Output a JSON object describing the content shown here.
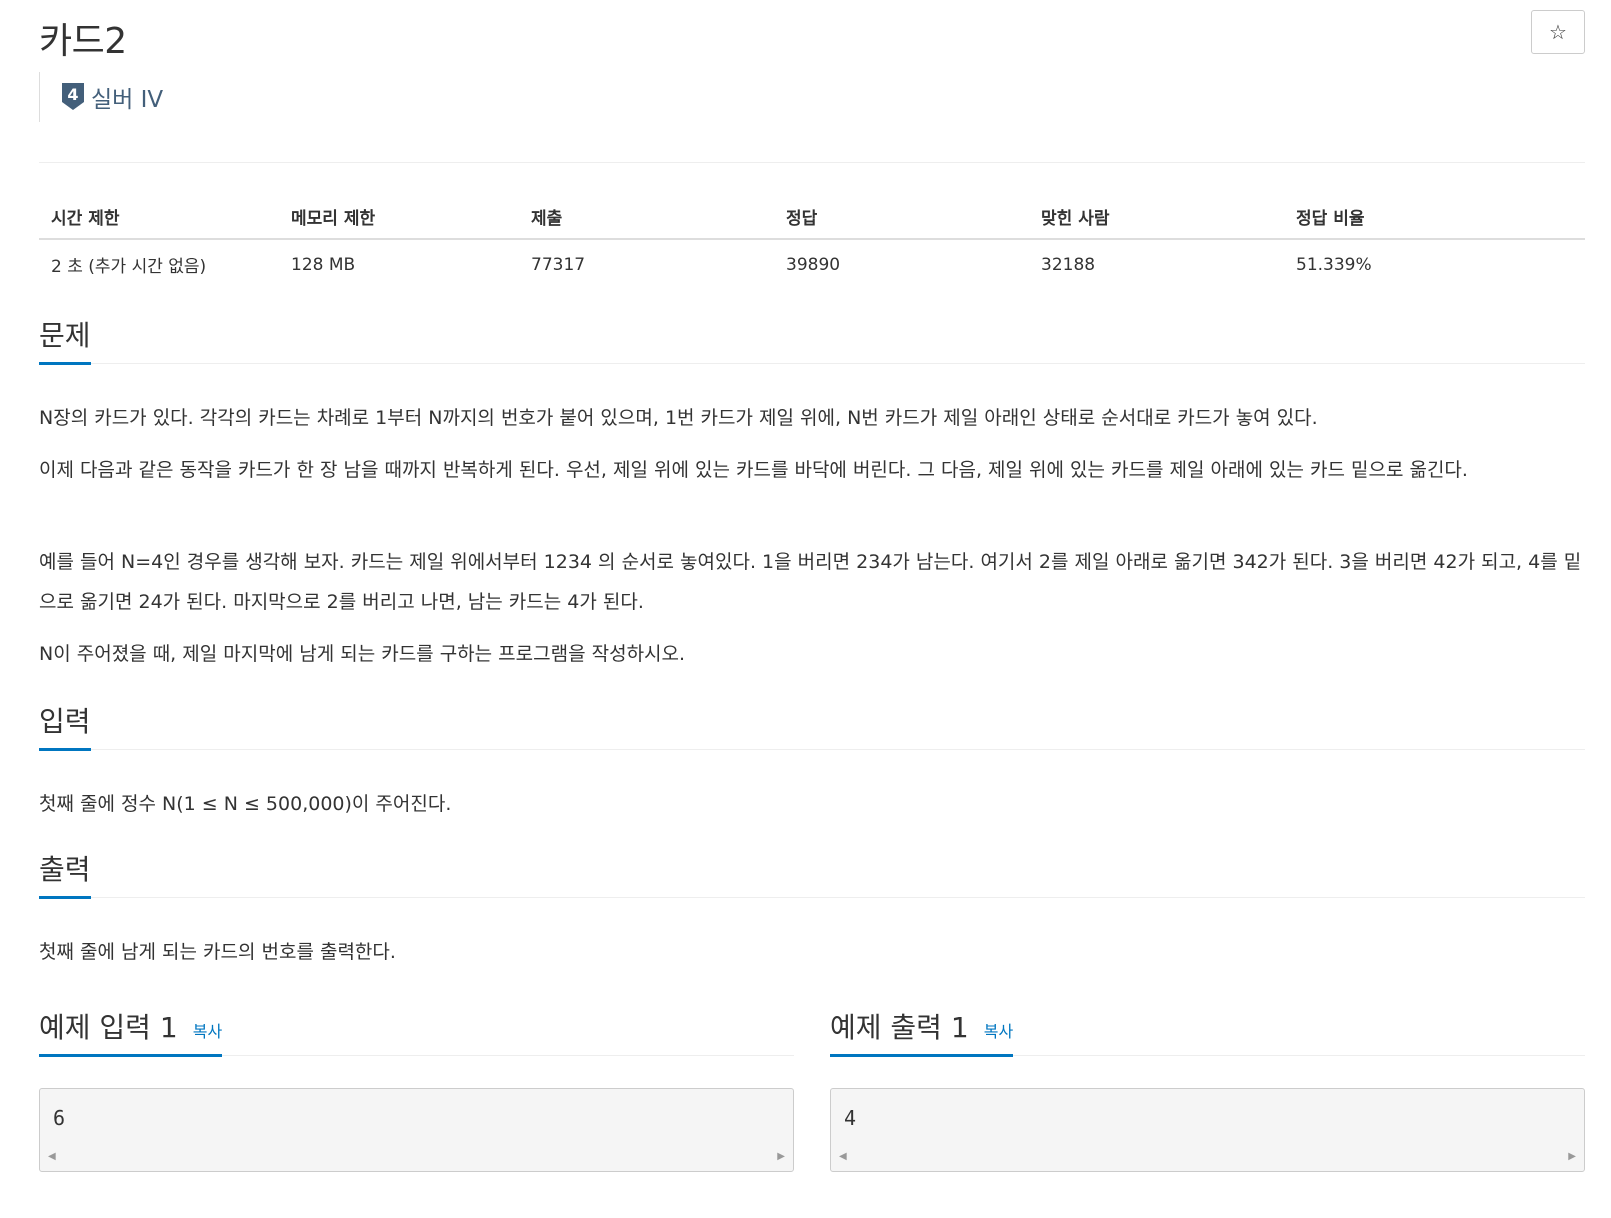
{
  "problem": {
    "title": "카드2",
    "star_icon": "☆",
    "tier": {
      "number": "4",
      "label": "실버 IV",
      "color": "#435f7a"
    }
  },
  "info": {
    "headers": [
      "시간 제한",
      "메모리 제한",
      "제출",
      "정답",
      "맞힌 사람",
      "정답 비율"
    ],
    "values": [
      "2 초 (추가 시간 없음)",
      "128 MB",
      "77317",
      "39890",
      "32188",
      "51.339%"
    ]
  },
  "sections": {
    "problem": {
      "title": "문제",
      "paragraphs": [
        "N장의 카드가 있다. 각각의 카드는 차례로 1부터 N까지의 번호가 붙어 있으며, 1번 카드가 제일 위에, N번 카드가 제일 아래인 상태로 순서대로 카드가 놓여 있다.",
        "이제 다음과 같은 동작을 카드가 한 장 남을 때까지 반복하게 된다. 우선, 제일 위에 있는 카드를 바닥에 버린다. 그 다음, 제일 위에 있는 카드를 제일 아래에 있는 카드 밑으로 옮긴다.",
        "예를 들어 N=4인 경우를 생각해 보자. 카드는 제일 위에서부터 1234 의 순서로 놓여있다. 1을 버리면 234가 남는다. 여기서 2를 제일 아래로 옮기면 342가 된다. 3을 버리면 42가 되고, 4를 밑으로 옮기면 24가 된다. 마지막으로 2를 버리고 나면, 남는 카드는 4가 된다.",
        "N이 주어졌을 때, 제일 마지막에 남게 되는 카드를 구하는 프로그램을 작성하시오."
      ]
    },
    "input": {
      "title": "입력",
      "text": "첫째 줄에 정수 N(1 ≤ N ≤ 500,000)이 주어진다."
    },
    "output": {
      "title": "출력",
      "text": "첫째 줄에 남게 되는 카드의 번호를 출력한다."
    }
  },
  "samples": {
    "input": {
      "title": "예제 입력 1",
      "copy_label": "복사",
      "value": "6"
    },
    "output": {
      "title": "예제 출력 1",
      "copy_label": "복사",
      "value": "4"
    }
  },
  "colors": {
    "accent": "#0076c0",
    "tier": "#435f7a"
  }
}
